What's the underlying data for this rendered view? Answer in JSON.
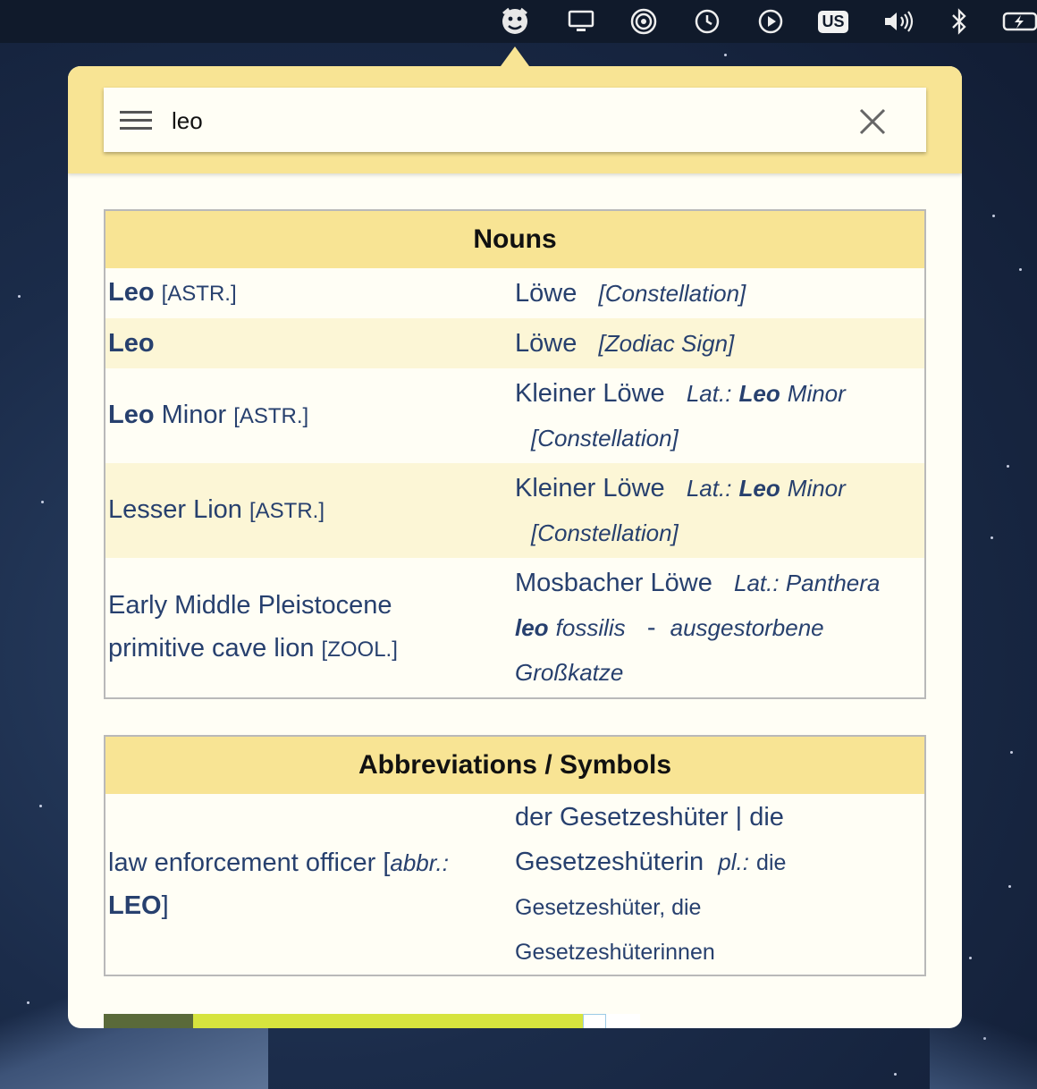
{
  "menubar": {
    "keyboard_layout": "US",
    "icons": [
      "leo-lion-icon",
      "display-icon",
      "airdrop-icon",
      "time-machine-icon",
      "play-icon",
      "keyboard-layout-icon",
      "volume-icon",
      "bluetooth-icon",
      "battery-icon"
    ]
  },
  "search": {
    "query": "leo"
  },
  "sections": {
    "nouns": {
      "title": "Nouns",
      "rows": [
        {
          "en_main": "Leo",
          "en_tag": "[ASTR.]",
          "de_main": "Löwe",
          "de_note": "[Constellation]"
        },
        {
          "en_main": "Leo",
          "de_main": "Löwe",
          "de_note": "[Zodiac Sign]"
        },
        {
          "en_main": "Leo",
          "en_rest": "Minor",
          "en_tag": "[ASTR.]",
          "de_main": "Kleiner Löwe",
          "de_lat": "Lat.:",
          "de_lat_bold": "Leo",
          "de_lat_rest": "Minor",
          "de_note": "[Constellation]"
        },
        {
          "en_rest": "Lesser Lion",
          "en_tag": "[ASTR.]",
          "de_main": "Kleiner Löwe",
          "de_lat": "Lat.:",
          "de_lat_bold": "Leo",
          "de_lat_rest": "Minor",
          "de_note": "[Constellation]"
        },
        {
          "en_line1": "Early Middle Pleistocene",
          "en_line2": "primitive cave lion",
          "en_tag": "[ZOOL.]",
          "de_main": "Mosbacher Löwe",
          "de_lat": "Lat.: Panthera",
          "de_lat_bold": "leo",
          "de_lat_rest": "fossilis",
          "de_dash": "-",
          "de_desc1": "ausgestorbene",
          "de_desc2": "Großkatze"
        }
      ]
    },
    "abbreviations": {
      "title": "Abbreviations / Symbols",
      "rows": [
        {
          "en_text": "law enforcement officer [",
          "en_abbr": "abbr.:",
          "en_bold": "LEO",
          "en_close": "]",
          "de_line1": "der Gesetzeshüter | die",
          "de_line2": "Gesetzeshüterin",
          "de_pl": "pl.:",
          "de_pl_rest": "die",
          "de_line3": "Gesetzeshüter, die",
          "de_line4": "Gesetzeshüterinnen"
        }
      ]
    }
  },
  "colors": {
    "accent_yellow": "#f8e494",
    "row_alt": "#fcf6d6",
    "text_blue": "#27406e",
    "background": "#fffef5"
  }
}
